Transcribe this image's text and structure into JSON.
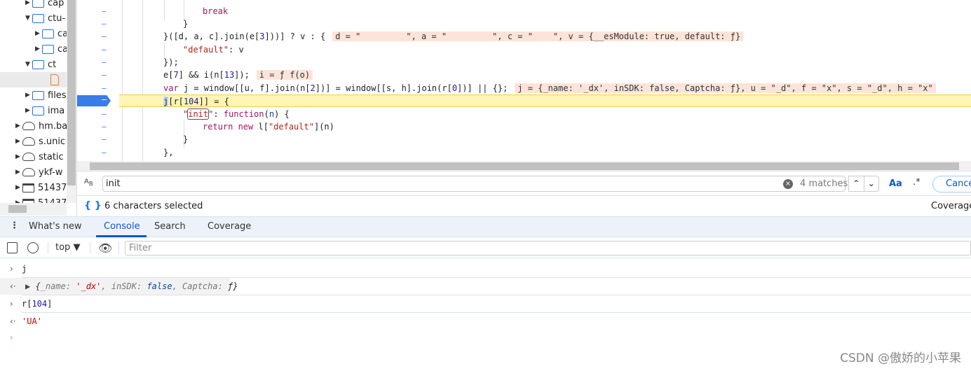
{
  "navigator": {
    "items": [
      {
        "label": "cap",
        "type": "folder",
        "expanded": false
      },
      {
        "label": "ctu-",
        "type": "folder",
        "expanded": true
      },
      {
        "label": "ca",
        "type": "folder",
        "expanded": false
      },
      {
        "label": "ca",
        "type": "folder",
        "expanded": false
      },
      {
        "label": "ct",
        "type": "folder",
        "expanded": true
      },
      {
        "label": "",
        "type": "file",
        "selected": true
      },
      {
        "label": "files",
        "type": "folder",
        "expanded": false
      },
      {
        "label": "ima",
        "type": "folder",
        "expanded": false
      },
      {
        "label": "hm.ba",
        "type": "cloud",
        "expanded": false
      },
      {
        "label": "s.unic",
        "type": "cloud",
        "expanded": false
      },
      {
        "label": "static",
        "type": "cloud",
        "expanded": false
      },
      {
        "label": "ykf-w",
        "type": "cloud",
        "expanded": false
      },
      {
        "label": "51437",
        "type": "frame",
        "expanded": false
      },
      {
        "label": "51437",
        "type": "frame",
        "expanded": false
      }
    ]
  },
  "code": {
    "gutter_marker": "–",
    "inline_values": {
      "line3": "d = \"         \", a = \"         \", c = \"    \", v = {__esModule: true, default: ƒ}",
      "line6": "i = ƒ f(o)",
      "line8": "j = {_name: '_dx', inSDK: false, Captcha: ƒ}, u = \"_d\", f = \"x\", s = \"_d\", h = \"x\""
    }
  },
  "search": {
    "value": "init",
    "matches": "4 matches",
    "case_label": "Aa",
    "regex_label": ".*",
    "cancel_label": "Cancel"
  },
  "status": {
    "text": "6 characters selected",
    "coverage": "Coverage"
  },
  "drawer": {
    "tabs": [
      "What's new",
      "Console",
      "Search",
      "Coverage"
    ],
    "active": "Console"
  },
  "console_toolbar": {
    "context": "top",
    "filter_placeholder": "Filter"
  },
  "console": {
    "in1": "j",
    "out1": {
      "name_key": "_name",
      "name_val": "'_dx'",
      "insdk_key": "inSDK",
      "insdk_val": "false",
      "captcha_key": "Captcha",
      "captcha_val": "ƒ"
    },
    "in2_a": "r[",
    "in2_b": "104",
    "in2_c": "]",
    "out2": "'UA'"
  },
  "watermark": "CSDN @傲娇的小苹果",
  "colors": {
    "accent": "#0b57d0",
    "current_line": "#fef5b3",
    "inline_value_bg": "#fde3d9"
  }
}
